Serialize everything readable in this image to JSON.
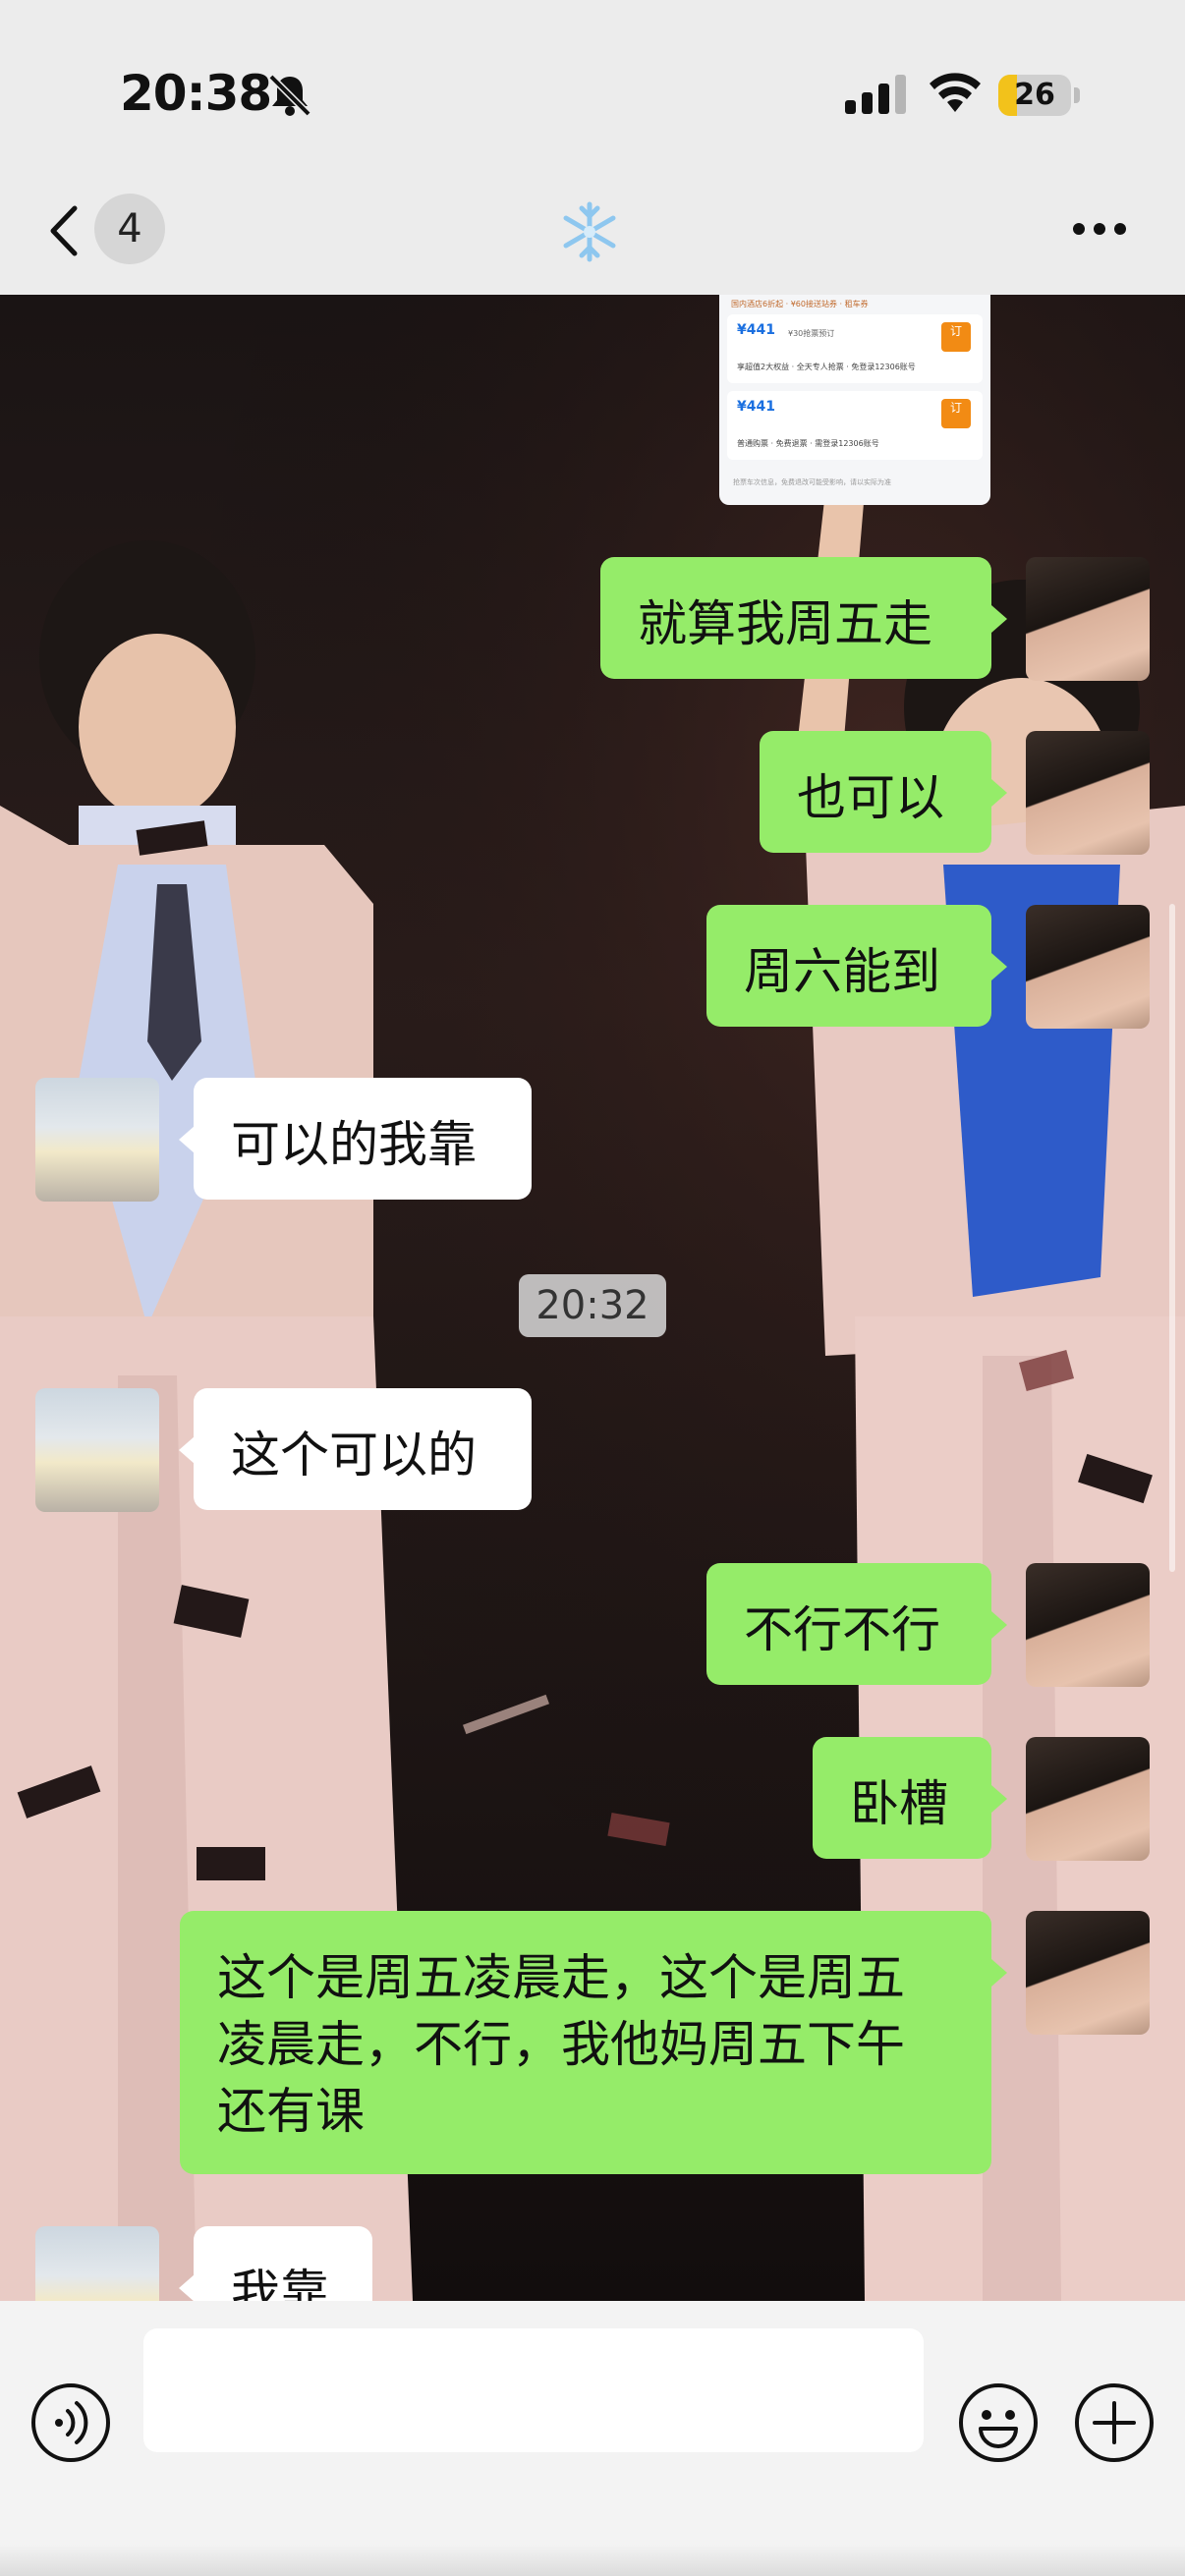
{
  "status_bar": {
    "time": "20:38",
    "battery_level": "26",
    "battery_fraction": 0.26,
    "icons": [
      "bell-muted-icon",
      "cellular-signal-icon",
      "wifi-icon",
      "battery-icon"
    ]
  },
  "nav": {
    "back_icon": "chevron-left-icon",
    "unread_count": "4",
    "title_icon": "snowflake-icon",
    "more_icon": "ellipsis-icon"
  },
  "shared_card": {
    "top_text": "国内酒店6折起 · ¥60接送站券 · 租车券",
    "rows": [
      {
        "price": "¥441",
        "note": "¥30抢票预订",
        "sub": "享超值2大权益 · 全天专人抢票 · 免登录12306账号",
        "book": "订"
      },
      {
        "price": "¥441",
        "note": "",
        "sub": "普通购票 · 免费退票 · 需登录12306账号",
        "book": "订"
      }
    ],
    "footer": "抢票车次信息，免费退改可能受影响，请以实际为准"
  },
  "messages": [
    {
      "side": "out",
      "text": "就算我周五走"
    },
    {
      "side": "out",
      "text": "也可以"
    },
    {
      "side": "out",
      "text": "周六能到"
    },
    {
      "side": "in",
      "text": "可以的我靠"
    },
    {
      "side": "in",
      "text": "这个可以的"
    },
    {
      "side": "out",
      "text": "不行不行"
    },
    {
      "side": "out",
      "text": "卧槽"
    },
    {
      "side": "out",
      "text": "这个是周五凌晨走，这个是周五\n凌晨走，不行，我他妈周五下午\n还有课"
    },
    {
      "side": "in",
      "text": "我靠"
    }
  ],
  "time_divider": "20:32",
  "input_bar": {
    "voice_icon": "voice-wave-icon",
    "input_value": "",
    "emoji_icon": "smiley-icon",
    "plus_icon": "plus-circle-icon"
  },
  "colors": {
    "outgoing_bubble": "#95ec69",
    "incoming_bubble": "#ffffff",
    "bar_background": "#ececec",
    "battery_fill": "#f2c21b"
  }
}
